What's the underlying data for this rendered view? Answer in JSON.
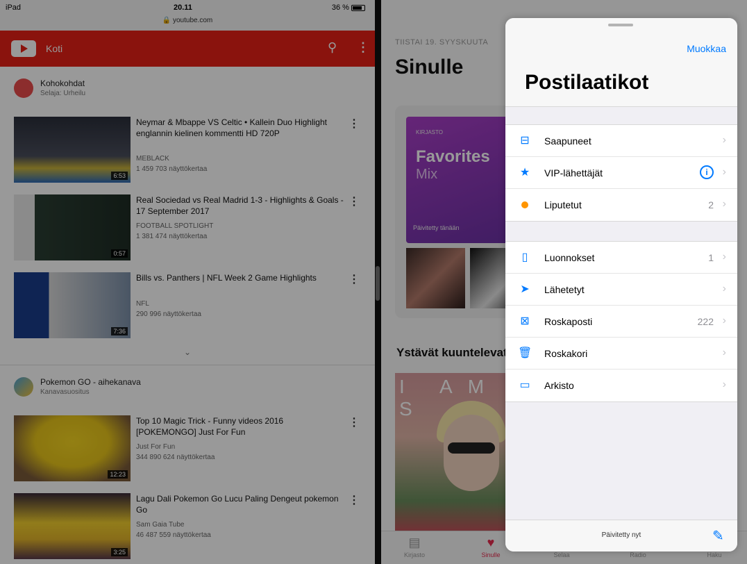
{
  "status": {
    "carrier": "iPad",
    "time": "20.11",
    "url": "youtube.com",
    "battery": "36 %"
  },
  "youtube": {
    "header_title": "Koti",
    "section1": {
      "title": "Kohokohdat",
      "subtitle": "Selaja: Urheilu"
    },
    "videos1": [
      {
        "title": "Neymar & Mbappe VS Celtic • Kallein Duo Highlight englannin kielinen kommentti HD 720P",
        "channel": "MEBLACK",
        "views": "1 459 703 näyttökertaa",
        "duration": "6:53"
      },
      {
        "title": "Real Sociedad vs Real Madrid 1-3 - Highlights & Goals - 17 September 2017",
        "channel": "FOOTBALL SPOTLIGHT",
        "views": "1 381 474 näyttökertaa",
        "duration": "0:57"
      },
      {
        "title": "Bills vs. Panthers | NFL Week 2 Game Highlights",
        "channel": "NFL",
        "views": "290 996 näyttökertaa",
        "duration": "7:36"
      }
    ],
    "section2": {
      "title": "Pokemon GO - aihekanava",
      "subtitle": "Kanavasuositus"
    },
    "videos2": [
      {
        "title": "Top 10 Magic Trick - Funny videos 2016 [POKEMONGO] Just For Fun",
        "channel": "Just For Fun",
        "views": "344 890 624 näyttökertaa",
        "duration": "12:23"
      },
      {
        "title": "Lagu Dali Pokemon Go Lucu Paling Dengeut pokemon Go",
        "channel": "Sam Gaia Tube",
        "views": "46 487 559 näyttökertaa",
        "duration": "3:25"
      }
    ],
    "expand_icon": "chevron-down-icon"
  },
  "music": {
    "date": "TIISTAI 19. SYYSKUUTA",
    "title": "Sinulle",
    "card_label": "KIRJASTO",
    "mix_title": "Favorites",
    "mix_sub": "Mix",
    "mix_note": "Päivitetty tänään",
    "friends": "Ystävät kuuntelevat",
    "album_text": "I AM S",
    "tabs": [
      {
        "label": "Kirjasto",
        "icon": "library-icon"
      },
      {
        "label": "Sinulle",
        "icon": "heart-icon"
      },
      {
        "label": "Selaa",
        "icon": "music-note-icon"
      },
      {
        "label": "Radio",
        "icon": "radio-icon"
      },
      {
        "label": "Haku",
        "icon": "search-icon"
      }
    ]
  },
  "mail": {
    "edit": "Muokkaa",
    "title": "Postilaatikot",
    "group1": [
      {
        "label": "Saapuneet",
        "count": "",
        "icon": "inbox-icon"
      },
      {
        "label": "VIP-lähettäjät",
        "count": "",
        "icon": "star-icon"
      },
      {
        "label": "Liputetut",
        "count": "2",
        "icon": "flag-dot-icon"
      }
    ],
    "group2": [
      {
        "label": "Luonnokset",
        "count": "1",
        "icon": "draft-icon"
      },
      {
        "label": "Lähetetyt",
        "count": "",
        "icon": "send-icon"
      },
      {
        "label": "Roskaposti",
        "count": "222",
        "icon": "junk-icon"
      },
      {
        "label": "Roskakori",
        "count": "",
        "icon": "trash-icon"
      },
      {
        "label": "Arkisto",
        "count": "",
        "icon": "archive-icon"
      }
    ],
    "updated": "Päivitetty nyt",
    "accent": "#007aff"
  }
}
